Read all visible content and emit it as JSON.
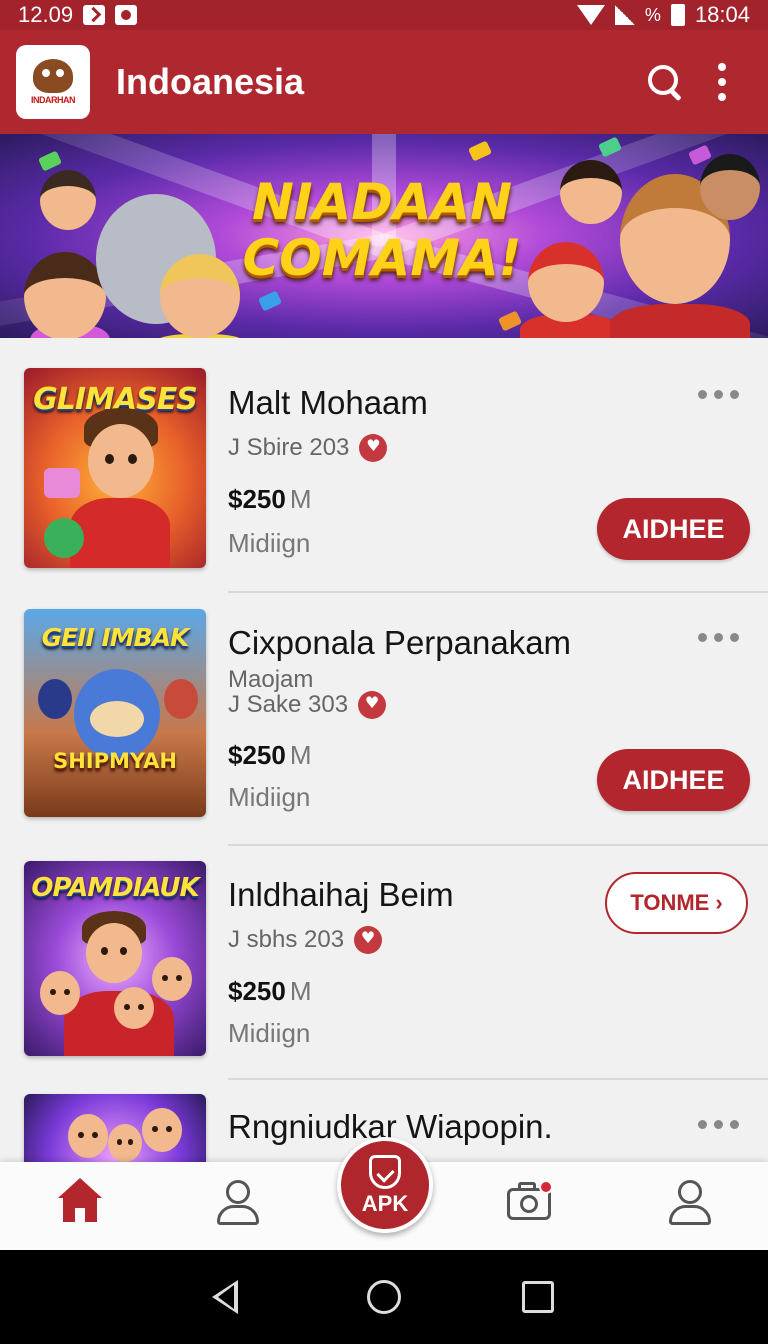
{
  "status_bar": {
    "time_left": "12.09",
    "battery_text": "%",
    "time_right": "18:04"
  },
  "app_bar": {
    "logo_text": "INDARHAN",
    "title": "Indoanesia"
  },
  "banner": {
    "line1": "NIADAAN",
    "line2": "COMAMA!"
  },
  "items": [
    {
      "thumb_title": "GLIMASES",
      "thumb_sub": "",
      "title": "Malt Mohaam",
      "sub": "",
      "meta": "J Sbire 203",
      "price": "$250",
      "unit": "M",
      "note": "Midiign",
      "action": "AIDHEE"
    },
    {
      "thumb_title": "GEII IMBAK",
      "thumb_sub": "SHIPMYAH",
      "title": "Cixponala Perpanakam",
      "sub": "Maojam",
      "meta": "J Sake 303",
      "price": "$250",
      "unit": "M",
      "note": "Midiign",
      "action": "AIDHEE"
    },
    {
      "thumb_title": "OPAMDIAUK",
      "thumb_sub": "",
      "title": "Inldhaihaj Beim",
      "sub": "",
      "meta": "J sbhs 203",
      "price": "$250",
      "unit": "M",
      "note": "Midiign",
      "action": "TONME"
    },
    {
      "thumb_title": "",
      "thumb_sub": "",
      "title": "Rngniudkar Wiapopin.",
      "sub": "",
      "meta": "",
      "price": "",
      "unit": "",
      "note": "",
      "action": ""
    }
  ],
  "bottom_nav": {
    "apk_label": "APK"
  },
  "colors": {
    "primary": "#b0282f",
    "status_bar": "#a3232c",
    "background": "#f1f1f1"
  },
  "icons": [
    "search-icon",
    "more-vert-icon",
    "home-icon",
    "user-icon",
    "apk-shield-icon",
    "camera-icon",
    "profile-icon"
  ]
}
